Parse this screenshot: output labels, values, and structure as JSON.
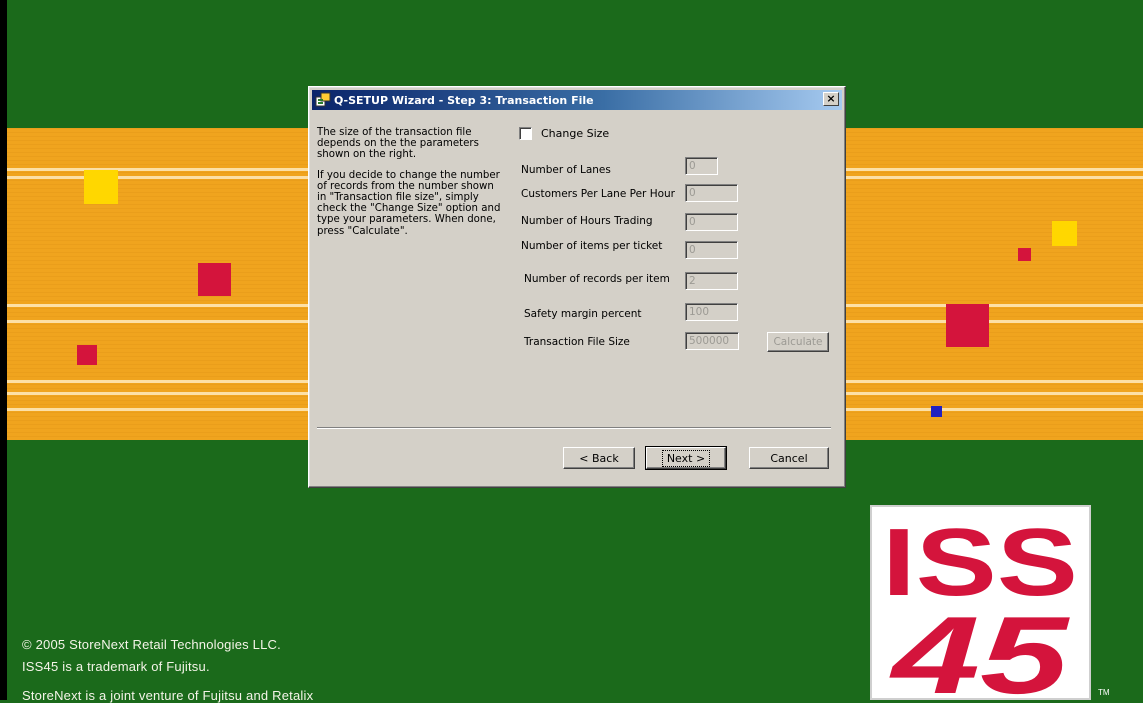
{
  "window": {
    "title": "Q-SETUP Wizard - Step 3: Transaction File",
    "close_glyph": "×"
  },
  "description": {
    "paragraph1": "The size of the transaction file depends on the the parameters shown on the right.",
    "paragraph2": "If you decide to change the number of records from the number shown in \"Transaction file size\", simply check the \"Change Size\" option and type your parameters. When done, press \"Calculate\"."
  },
  "change_size": {
    "label": "Change Size",
    "checked": false
  },
  "fields": [
    {
      "label": "Number of Lanes",
      "value": "0"
    },
    {
      "label": "Customers Per Lane Per Hour",
      "value": "0"
    },
    {
      "label": "Number of Hours Trading",
      "value": "0"
    },
    {
      "label": "Number of items per ticket",
      "value": "0"
    },
    {
      "label": "Number of records per item",
      "value": "2"
    },
    {
      "label": "Safety margin percent",
      "value": "100"
    },
    {
      "label": "Transaction File Size",
      "value": "500000"
    }
  ],
  "buttons": {
    "calculate": "Calculate",
    "back": "< Back",
    "next": "Next >",
    "cancel": "Cancel"
  },
  "footer": {
    "copyright": "© 2005 StoreNext Retail Technologies LLC.",
    "trademark": "ISS45 is a trademark of Fujitsu.",
    "joint_venture": "StoreNext is a joint venture of Fujitsu and Retalix"
  },
  "logo": {
    "line1": "ISS",
    "line2": "45",
    "tm": "TM"
  },
  "colors": {
    "background": "#1b6a1b",
    "band": "#f0a41e",
    "logo_red": "#d4143c",
    "square_yellow": "#ffd700",
    "square_red": "#d4143c",
    "square_blue": "#2222c0"
  }
}
